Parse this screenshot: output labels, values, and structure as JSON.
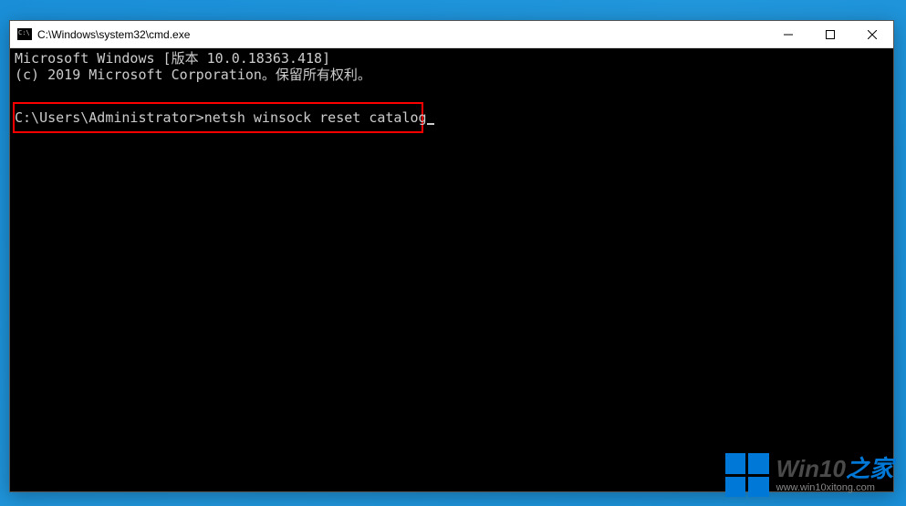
{
  "window": {
    "title": "C:\\Windows\\system32\\cmd.exe"
  },
  "terminal": {
    "line1": "Microsoft Windows [版本 10.0.18363.418]",
    "line2": "(c) 2019 Microsoft Corporation。保留所有权利。",
    "prompt": "C:\\Users\\Administrator>",
    "command": "netsh winsock reset catalog"
  },
  "watermark": {
    "title_main": "Win10",
    "title_accent": "之家",
    "url": "www.win10xitong.com"
  }
}
